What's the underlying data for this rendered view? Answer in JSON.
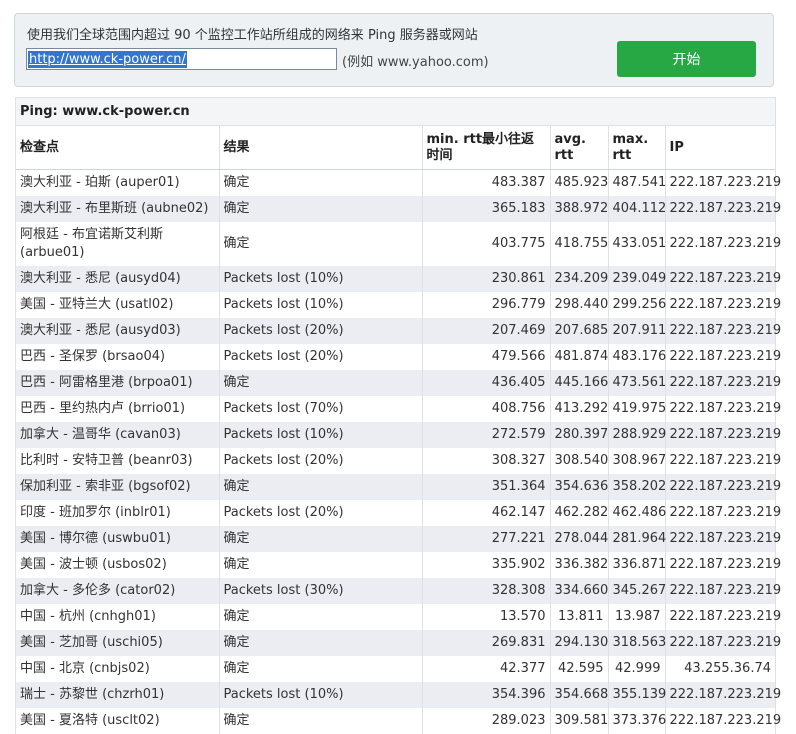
{
  "panel": {
    "description": "使用我们全球范围内超过 90 个监控工作站所组成的网络来 Ping 服务器或网站",
    "input_value": "http://www.ck-power.cn/",
    "example": "(例如 www.yahoo.com)",
    "start_label": "开始",
    "start_color": "#28a745"
  },
  "results": {
    "title": "Ping: www.ck-power.cn",
    "columns": [
      "检查点",
      "结果",
      "min. rtt最小往返时间",
      "avg. rtt",
      "max. rtt",
      "IP"
    ],
    "rows": [
      {
        "checkpoint": "澳大利亚 - 珀斯 (auper01)",
        "result": "确定",
        "min": "483.387",
        "avg": "485.923",
        "max": "487.541",
        "ip": "222.187.223.219"
      },
      {
        "checkpoint": "澳大利亚 - 布里斯班 (aubne02)",
        "result": "确定",
        "min": "365.183",
        "avg": "388.972",
        "max": "404.112",
        "ip": "222.187.223.219"
      },
      {
        "checkpoint": "阿根廷 - 布宜诺斯艾利斯 (arbue01)",
        "result": "确定",
        "min": "403.775",
        "avg": "418.755",
        "max": "433.051",
        "ip": "222.187.223.219"
      },
      {
        "checkpoint": "澳大利亚 - 悉尼 (ausyd04)",
        "result": "Packets lost (10%)",
        "min": "230.861",
        "avg": "234.209",
        "max": "239.049",
        "ip": "222.187.223.219"
      },
      {
        "checkpoint": "美国 - 亚特兰大 (usatl02)",
        "result": "Packets lost (10%)",
        "min": "296.779",
        "avg": "298.440",
        "max": "299.256",
        "ip": "222.187.223.219"
      },
      {
        "checkpoint": "澳大利亚 - 悉尼 (ausyd03)",
        "result": "Packets lost (20%)",
        "min": "207.469",
        "avg": "207.685",
        "max": "207.911",
        "ip": "222.187.223.219"
      },
      {
        "checkpoint": "巴西 - 圣保罗 (brsao04)",
        "result": "Packets lost (20%)",
        "min": "479.566",
        "avg": "481.874",
        "max": "483.176",
        "ip": "222.187.223.219"
      },
      {
        "checkpoint": "巴西 - 阿雷格里港 (brpoa01)",
        "result": "确定",
        "min": "436.405",
        "avg": "445.166",
        "max": "473.561",
        "ip": "222.187.223.219"
      },
      {
        "checkpoint": "巴西 - 里约热内卢 (brrio01)",
        "result": "Packets lost (70%)",
        "min": "408.756",
        "avg": "413.292",
        "max": "419.975",
        "ip": "222.187.223.219"
      },
      {
        "checkpoint": "加拿大 - 温哥华 (cavan03)",
        "result": "Packets lost (10%)",
        "min": "272.579",
        "avg": "280.397",
        "max": "288.929",
        "ip": "222.187.223.219"
      },
      {
        "checkpoint": "比利时 - 安特卫普 (beanr03)",
        "result": "Packets lost (20%)",
        "min": "308.327",
        "avg": "308.540",
        "max": "308.967",
        "ip": "222.187.223.219"
      },
      {
        "checkpoint": "保加利亚 - 索非亚 (bgsof02)",
        "result": "确定",
        "min": "351.364",
        "avg": "354.636",
        "max": "358.202",
        "ip": "222.187.223.219"
      },
      {
        "checkpoint": "印度 - 班加罗尔 (inblr01)",
        "result": "Packets lost (20%)",
        "min": "462.147",
        "avg": "462.282",
        "max": "462.486",
        "ip": "222.187.223.219"
      },
      {
        "checkpoint": "美国 - 博尔德 (uswbu01)",
        "result": "确定",
        "min": "277.221",
        "avg": "278.044",
        "max": "281.964",
        "ip": "222.187.223.219"
      },
      {
        "checkpoint": "美国 - 波士顿 (usbos02)",
        "result": "确定",
        "min": "335.902",
        "avg": "336.382",
        "max": "336.871",
        "ip": "222.187.223.219"
      },
      {
        "checkpoint": "加拿大 - 多伦多 (cator02)",
        "result": "Packets lost (30%)",
        "min": "328.308",
        "avg": "334.660",
        "max": "345.267",
        "ip": "222.187.223.219"
      },
      {
        "checkpoint": "中国 - 杭州 (cnhgh01)",
        "result": "确定",
        "min": "13.570",
        "avg": "13.811",
        "max": "13.987",
        "ip": "222.187.223.219"
      },
      {
        "checkpoint": "美国 - 芝加哥 (uschi05)",
        "result": "确定",
        "min": "269.831",
        "avg": "294.130",
        "max": "318.563",
        "ip": "222.187.223.219"
      },
      {
        "checkpoint": "中国 - 北京 (cnbjs02)",
        "result": "确定",
        "min": "42.377",
        "avg": "42.595",
        "max": "42.999",
        "ip": "43.255.36.74"
      },
      {
        "checkpoint": "瑞士 - 苏黎世 (chzrh01)",
        "result": "Packets lost (10%)",
        "min": "354.396",
        "avg": "354.668",
        "max": "355.139",
        "ip": "222.187.223.219"
      },
      {
        "checkpoint": "美国 - 夏洛特 (usclt02)",
        "result": "确定",
        "min": "289.023",
        "avg": "309.581",
        "max": "373.376",
        "ip": "222.187.223.219"
      }
    ]
  }
}
